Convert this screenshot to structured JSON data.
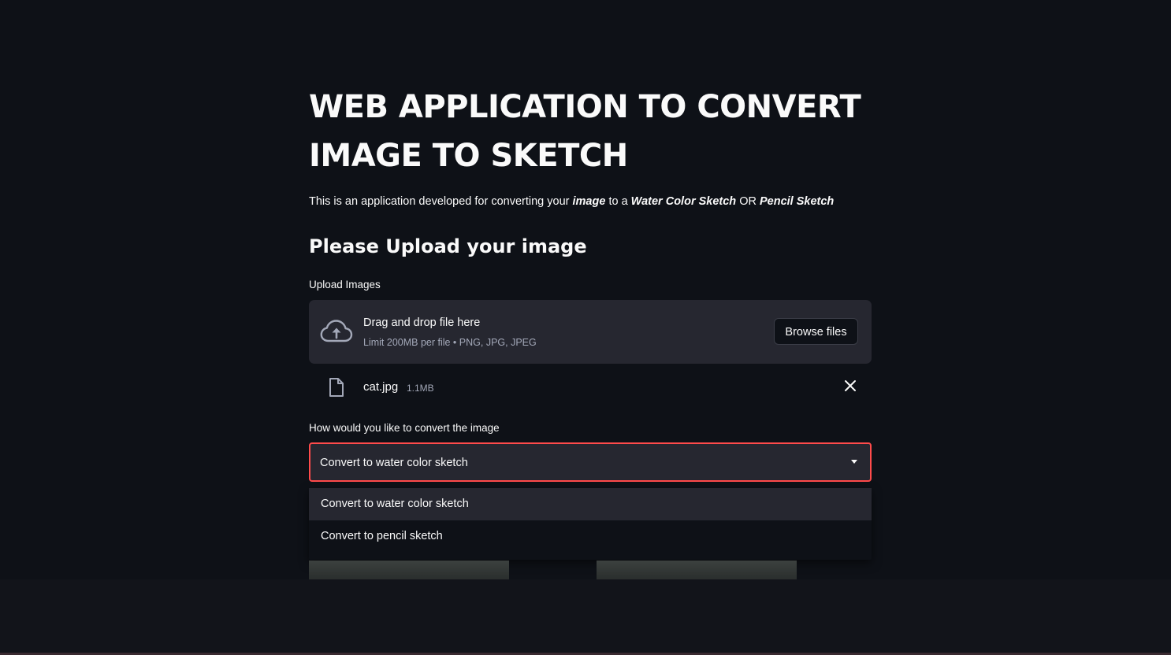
{
  "header": {
    "title": "WEB APPLICATION TO CONVERT IMAGE TO SKETCH"
  },
  "intro": {
    "prefix": "This is an application developed for converting your ",
    "emph1": "image",
    "mid1": " to a ",
    "emph2": "Water Color Sketch",
    "mid2": " OR ",
    "emph3": "Pencil Sketch"
  },
  "upload": {
    "heading": "Please Upload your image",
    "label": "Upload Images",
    "drag_text": "Drag and drop file here",
    "limit_text": "Limit 200MB per file • PNG, JPG, JPEG",
    "browse_label": "Browse files",
    "icon": "cloud-upload-icon"
  },
  "uploaded_file": {
    "name": "cat.jpg",
    "size": "1.1MB",
    "icon": "file-icon",
    "remove_icon": "close-icon"
  },
  "convert": {
    "label": "How would you like to convert the image",
    "selected": "Convert to water color sketch",
    "options": [
      "Convert to water color sketch",
      "Convert to pencil sketch"
    ],
    "active_index": 0
  },
  "colors": {
    "background": "#0e1117",
    "widget_bg": "#262730",
    "accent": "#ff4b4b",
    "muted_text": "#a3a8b8"
  }
}
